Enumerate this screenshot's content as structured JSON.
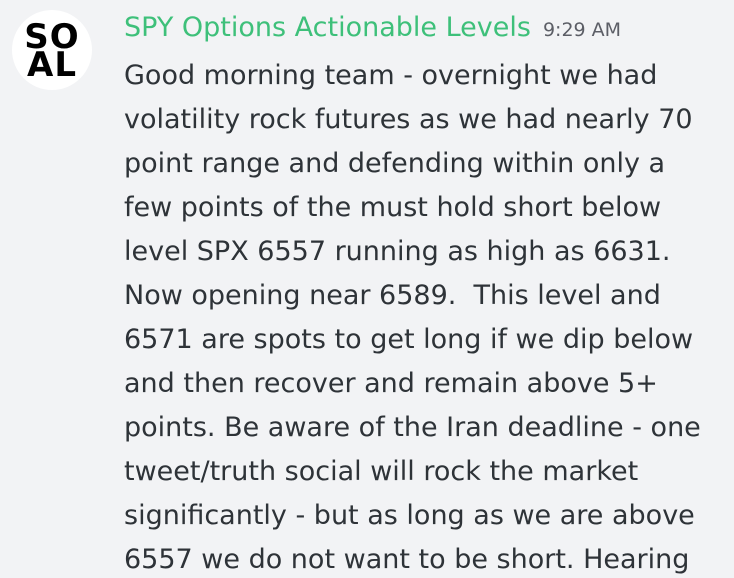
{
  "message": {
    "avatar": {
      "line1": "SO",
      "line2": "AL"
    },
    "author": "SPY Options Actionable Levels",
    "timestamp": "9:29 AM",
    "lines": [
      "Good morning team - overnight we had",
      "volatility rock futures as we had nearly 70",
      "point range and defending within only a",
      "few points of the must hold short below",
      "level SPX 6557 running as high as 6631.",
      "Now opening near 6589.  This level and",
      "6571 are spots to get long if we dip below",
      "and then recover and remain above 5+",
      "points. Be aware of the Iran deadline - one",
      "tweet/truth social will rock the market",
      "significantly - but as long as we are above",
      "6557 we do not want to be short. Hearing"
    ]
  },
  "colors": {
    "background": "#f2f3f5",
    "author": "#3ec07a",
    "timestamp": "#5c5e66",
    "text": "#2e3338"
  }
}
